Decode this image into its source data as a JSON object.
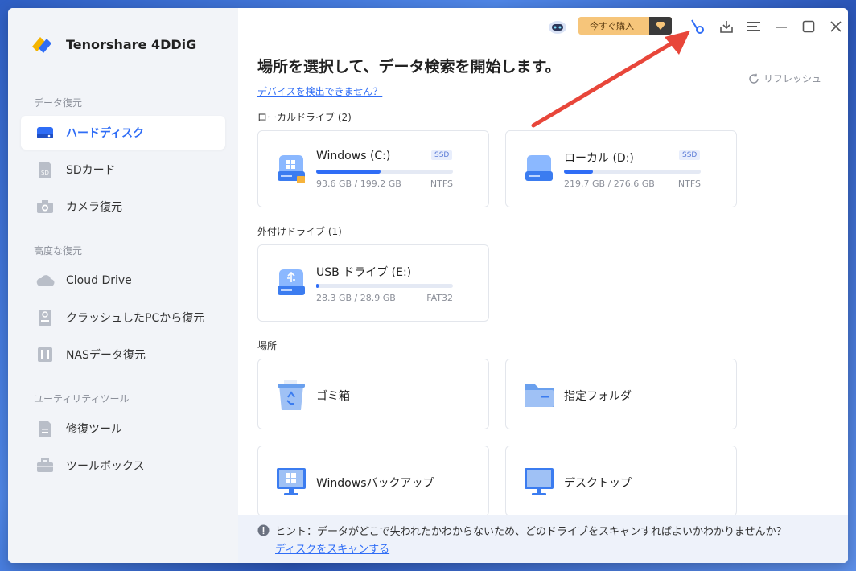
{
  "app": {
    "name": "Tenorshare 4DDiG"
  },
  "sidebar": {
    "sections": [
      {
        "title": "データ復元"
      },
      {
        "title": "高度な復元"
      },
      {
        "title": "ユーティリティツール"
      }
    ],
    "items": [
      {
        "label": "ハードディスク",
        "icon": "hard-disk-icon",
        "active": true
      },
      {
        "label": "SDカード",
        "icon": "sd-card-icon"
      },
      {
        "label": "カメラ復元",
        "icon": "camera-icon"
      },
      {
        "label": "Cloud Drive",
        "icon": "cloud-icon"
      },
      {
        "label": "クラッシュしたPCから復元",
        "icon": "crashed-pc-icon"
      },
      {
        "label": "NASデータ復元",
        "icon": "nas-icon"
      },
      {
        "label": "修復ツール",
        "icon": "repair-icon"
      },
      {
        "label": "ツールボックス",
        "icon": "toolbox-icon"
      }
    ]
  },
  "topbar": {
    "buy_label": "今すぐ購入"
  },
  "main": {
    "title": "場所を選択して、データ検索を開始します。",
    "detect_link": "デバイスを検出できません？",
    "refresh_label": "リフレッシュ",
    "local_drives_title": "ローカルドライブ (2)",
    "external_drives_title": "外付けドライブ (1)",
    "places_title": "場所",
    "drives": [
      {
        "name": "Windows (C:)",
        "badge": "SSD",
        "used_fraction": 0.47,
        "size": "93.6 GB / 199.2 GB",
        "fs": "NTFS"
      },
      {
        "name": "ローカル (D:)",
        "badge": "SSD",
        "used_fraction": 0.21,
        "size": "219.7 GB / 276.6 GB",
        "fs": "NTFS"
      },
      {
        "name": "USB ドライブ (E:)",
        "badge": "",
        "used_fraction": 0.02,
        "size": "28.3 GB / 28.9 GB",
        "fs": "FAT32"
      }
    ],
    "places": [
      {
        "label": "ゴミ箱",
        "icon": "recycle-bin-icon"
      },
      {
        "label": "指定フォルダ",
        "icon": "folder-icon"
      },
      {
        "label": "Windowsバックアップ",
        "icon": "windows-backup-icon"
      },
      {
        "label": "デスクトップ",
        "icon": "desktop-icon"
      }
    ],
    "hint_text": "ヒント：データがどこで失われたかわからないため、どのドライブをスキャンすればよいかわかりませんか？",
    "hint_link": "ディスクをスキャンする"
  },
  "colors": {
    "accent": "#2f6df6",
    "sidebar_bg": "#f2f4f8",
    "arrow": "#e8463a"
  }
}
